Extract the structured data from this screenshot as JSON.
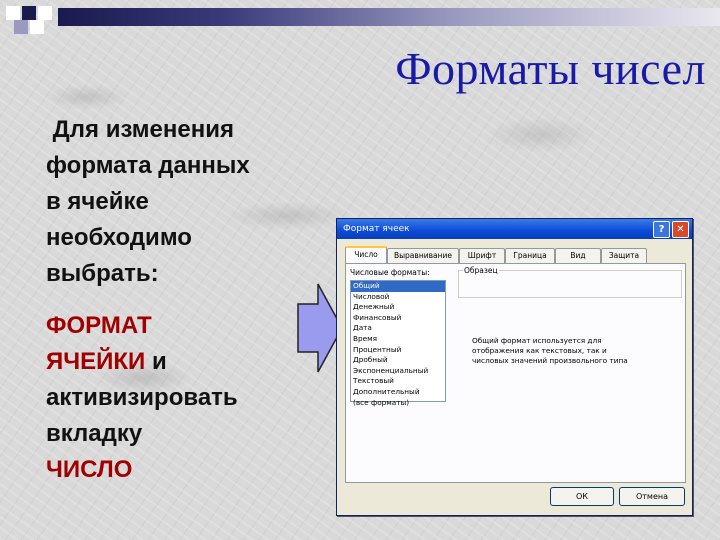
{
  "slide": {
    "title": "Форматы чисел",
    "body_line1": "Для изменения",
    "body_line2": "формата данных",
    "body_line3": "в ячейке",
    "body_line4": "необходимо",
    "body_line5": "выбрать:",
    "format_cells_1": "ФОРМАТ",
    "format_cells_2": "ЯЧЕЙКИ",
    "and_word": " и",
    "activate": "активизировать",
    "tab_word": "вкладку",
    "number_word": "ЧИСЛО"
  },
  "colors": {
    "title": "#1a1aa8",
    "highlight": "#a00000",
    "arrow_fill": "#9a9aee"
  },
  "dialog": {
    "title": "Формат ячеек",
    "help_icon": "?",
    "close_icon": "✕",
    "tabs": [
      "Число",
      "Выравнивание",
      "Шрифт",
      "Граница",
      "Вид",
      "Защита"
    ],
    "active_tab": "Число",
    "category_label": "Числовые форматы:",
    "categories": [
      "Общий",
      "Числовой",
      "Денежный",
      "Финансовый",
      "Дата",
      "Время",
      "Процентный",
      "Дробный",
      "Экспоненциальный",
      "Текстовый",
      "Дополнительный",
      "(все форматы)"
    ],
    "selected_category": "Общий",
    "sample_label": "Образец",
    "description_line1": "Общий формат используется для",
    "description_line2": "отображения как текстовых, так и",
    "description_line3": "числовых значений произвольного типа",
    "ok_label": "ОК",
    "cancel_label": "Отмена"
  }
}
